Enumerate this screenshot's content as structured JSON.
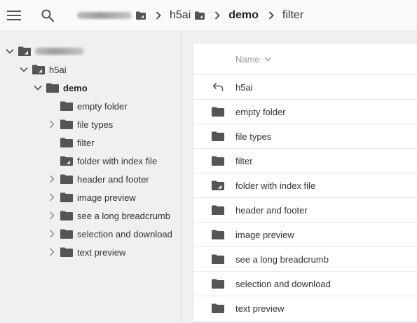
{
  "topbar": {
    "menu_icon": "hamburger-menu-icon",
    "search_icon": "search-icon",
    "breadcrumb": [
      {
        "label": "",
        "redacted": true
      },
      {
        "label": "h5ai"
      },
      {
        "label": "demo",
        "current": false
      },
      {
        "label": "filter",
        "current": true
      }
    ]
  },
  "sidebar": {
    "root_label": "",
    "h5ai_label": "h5ai",
    "demo_label": "demo",
    "items": [
      {
        "label": "empty folder",
        "expandable": false,
        "icon": "folder-icon"
      },
      {
        "label": "file types",
        "expandable": true,
        "icon": "folder-icon"
      },
      {
        "label": "filter",
        "expandable": false,
        "icon": "folder-icon"
      },
      {
        "label": "folder with index file",
        "expandable": false,
        "icon": "folder-index-icon"
      },
      {
        "label": "header and footer",
        "expandable": true,
        "icon": "folder-icon"
      },
      {
        "label": "image preview",
        "expandable": true,
        "icon": "folder-icon"
      },
      {
        "label": "see a long breadcrumb",
        "expandable": true,
        "icon": "folder-icon"
      },
      {
        "label": "selection and download",
        "expandable": true,
        "icon": "folder-icon"
      },
      {
        "label": "text preview",
        "expandable": true,
        "icon": "folder-icon"
      }
    ]
  },
  "listing": {
    "header_name": "Name",
    "rows": [
      {
        "label": "h5ai",
        "icon": "back-arrow-icon"
      },
      {
        "label": "empty folder",
        "icon": "folder-icon"
      },
      {
        "label": "file types",
        "icon": "folder-icon"
      },
      {
        "label": "filter",
        "icon": "folder-icon"
      },
      {
        "label": "folder with index file",
        "icon": "folder-index-icon"
      },
      {
        "label": "header and footer",
        "icon": "folder-icon"
      },
      {
        "label": "image preview",
        "icon": "folder-icon"
      },
      {
        "label": "see a long breadcrumb",
        "icon": "folder-icon"
      },
      {
        "label": "selection and download",
        "icon": "folder-icon"
      },
      {
        "label": "text preview",
        "icon": "folder-icon"
      }
    ]
  },
  "colors": {
    "icon": "#555555",
    "bar_background": "#fafafa",
    "sidebar_background": "#f0f0f0",
    "panel_background": "#ffffff"
  }
}
